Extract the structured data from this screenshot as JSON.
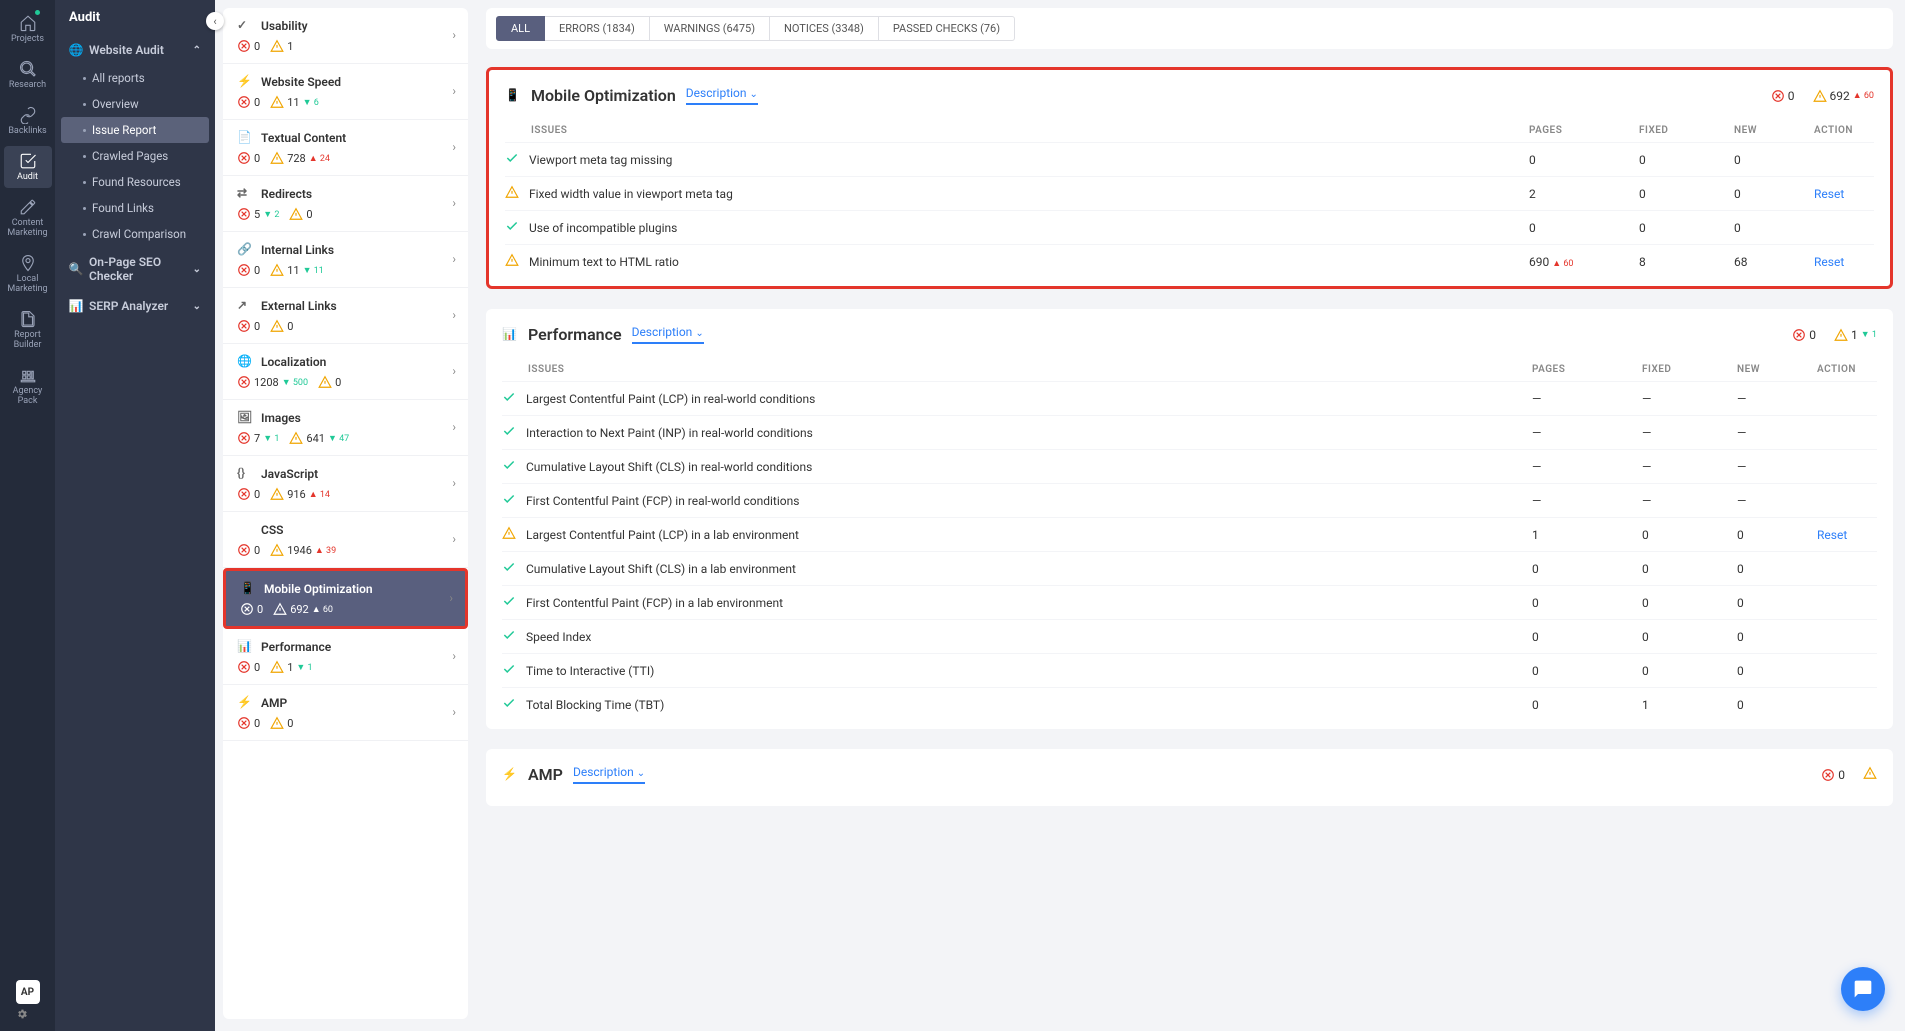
{
  "rail": [
    {
      "label": "Projects",
      "icon": "home"
    },
    {
      "label": "Research",
      "icon": "research"
    },
    {
      "label": "Backlinks",
      "icon": "link"
    },
    {
      "label": "Audit",
      "icon": "audit",
      "active": true
    },
    {
      "label": "Content Marketing",
      "icon": "pencil"
    },
    {
      "label": "Local Marketing",
      "icon": "pin"
    },
    {
      "label": "Report Builder",
      "icon": "doc"
    },
    {
      "label": "Agency Pack",
      "icon": "building"
    }
  ],
  "avatar": "AP",
  "sidebar": {
    "title": "Audit",
    "sections": [
      {
        "label": "Website Audit",
        "icon": "globe",
        "expanded": true,
        "items": [
          {
            "label": "All reports"
          },
          {
            "label": "Overview"
          },
          {
            "label": "Issue Report",
            "active": true
          },
          {
            "label": "Crawled Pages"
          },
          {
            "label": "Found Resources"
          },
          {
            "label": "Found Links"
          },
          {
            "label": "Crawl Comparison"
          }
        ]
      },
      {
        "label": "On-Page SEO Checker",
        "icon": "search"
      },
      {
        "label": "SERP Analyzer",
        "icon": "serp"
      }
    ]
  },
  "tabs": [
    {
      "label": "ALL",
      "active": true
    },
    {
      "label": "ERRORS (1834)"
    },
    {
      "label": "WARNINGS (6475)"
    },
    {
      "label": "NOTICES (3348)"
    },
    {
      "label": "PASSED CHECKS (76)"
    }
  ],
  "cats": [
    {
      "title": "Usability",
      "err": "0",
      "warn": "1"
    },
    {
      "title": "Website Speed",
      "err": "0",
      "warn": "11",
      "warn_delta": "▼ 6"
    },
    {
      "title": "Textual Content",
      "err": "0",
      "warn": "728",
      "warn_delta_up": "▲ 24"
    },
    {
      "title": "Redirects",
      "err": "5",
      "err_delta": "▼ 2",
      "warn": "0"
    },
    {
      "title": "Internal Links",
      "err": "0",
      "warn": "11",
      "warn_delta": "▼ 11"
    },
    {
      "title": "External Links",
      "err": "0",
      "warn": "0"
    },
    {
      "title": "Localization",
      "err": "1208",
      "err_delta": "▼ 500",
      "warn": "0"
    },
    {
      "title": "Images",
      "err": "7",
      "err_delta": "▼ 1",
      "warn": "641",
      "warn_delta": "▼ 47"
    },
    {
      "title": "JavaScript",
      "err": "0",
      "warn": "916",
      "warn_delta_up": "▲ 14"
    },
    {
      "title": "CSS",
      "err": "0",
      "warn": "1946",
      "warn_delta_up": "▲ 39"
    },
    {
      "title": "Mobile Optimization",
      "err": "0",
      "warn": "692",
      "warn_delta_up": "▲ 60",
      "selected": true
    },
    {
      "title": "Performance",
      "err": "0",
      "warn": "1",
      "warn_delta": "▼ 1"
    },
    {
      "title": "AMP",
      "err": "0",
      "warn": "0"
    }
  ],
  "headers": {
    "issues": "ISSUES",
    "pages": "PAGES",
    "fixed": "FIXED",
    "new": "NEW",
    "action": "ACTION"
  },
  "desc": "Description",
  "reset": "Reset",
  "panels": [
    {
      "title": "Mobile Optimization",
      "icon": "mobile",
      "hl": true,
      "err": "0",
      "warn": "692",
      "warn_delta": "▲ 60",
      "rows": [
        {
          "status": "ok",
          "issue": "Viewport meta tag missing",
          "p": "0",
          "f": "0",
          "n": "0"
        },
        {
          "status": "warn",
          "issue": "Fixed width value in viewport meta tag",
          "p": "2",
          "f": "0",
          "n": "0",
          "action": "reset"
        },
        {
          "status": "ok",
          "issue": "Use of incompatible plugins",
          "p": "0",
          "f": "0",
          "n": "0"
        },
        {
          "status": "warn",
          "issue": "Minimum text to HTML ratio",
          "p": "690",
          "p_delta": "▲ 60",
          "f": "8",
          "n": "68",
          "action": "reset"
        }
      ]
    },
    {
      "title": "Performance",
      "icon": "perf",
      "err": "0",
      "warn": "1",
      "warn_delta": "▼ 1",
      "rows": [
        {
          "status": "ok",
          "issue": "Largest Contentful Paint (LCP) in real-world conditions",
          "p": "—",
          "f": "—",
          "n": "—"
        },
        {
          "status": "ok",
          "issue": "Interaction to Next Paint (INP) in real-world conditions",
          "p": "—",
          "f": "—",
          "n": "—"
        },
        {
          "status": "ok",
          "issue": "Cumulative Layout Shift (CLS) in real-world conditions",
          "p": "—",
          "f": "—",
          "n": "—"
        },
        {
          "status": "ok",
          "issue": "First Contentful Paint (FCP) in real-world conditions",
          "p": "—",
          "f": "—",
          "n": "—"
        },
        {
          "status": "warn",
          "issue": "Largest Contentful Paint (LCP) in a lab environment",
          "p": "1",
          "f": "0",
          "n": "0",
          "action": "reset"
        },
        {
          "status": "ok",
          "issue": "Cumulative Layout Shift (CLS) in a lab environment",
          "p": "0",
          "f": "0",
          "n": "0"
        },
        {
          "status": "ok",
          "issue": "First Contentful Paint (FCP) in a lab environment",
          "p": "0",
          "f": "0",
          "n": "0"
        },
        {
          "status": "ok",
          "issue": "Speed Index",
          "p": "0",
          "f": "0",
          "n": "0"
        },
        {
          "status": "ok",
          "issue": "Time to Interactive (TTI)",
          "p": "0",
          "f": "0",
          "n": "0"
        },
        {
          "status": "ok",
          "issue": "Total Blocking Time (TBT)",
          "p": "0",
          "f": "1",
          "n": "0"
        }
      ]
    },
    {
      "title": "AMP",
      "icon": "amp",
      "err": "0",
      "warn": "",
      "rows": []
    }
  ]
}
